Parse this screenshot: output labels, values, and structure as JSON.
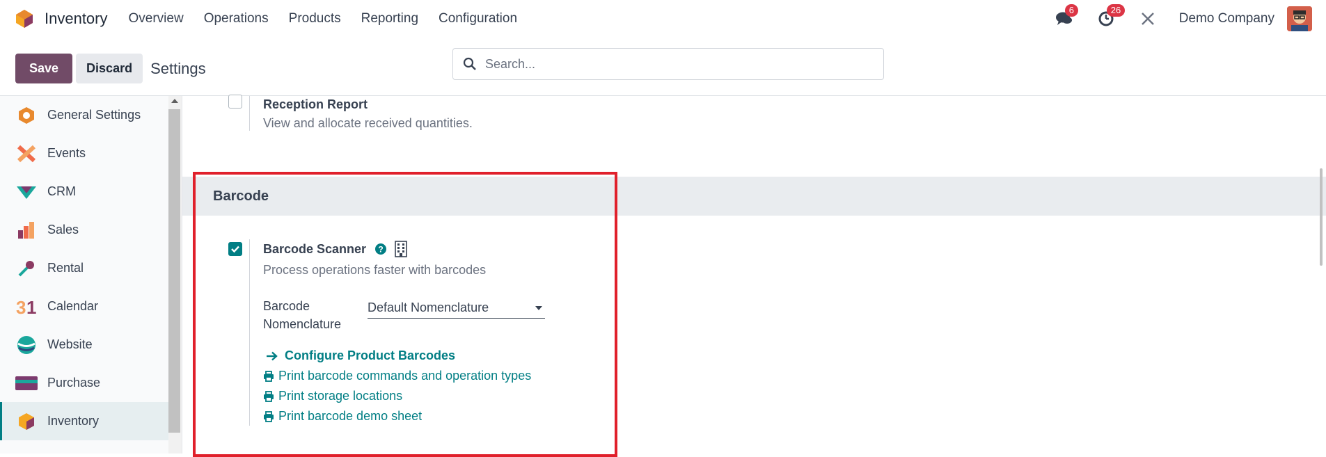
{
  "topnav": {
    "app_name": "Inventory",
    "menu": [
      "Overview",
      "Operations",
      "Products",
      "Reporting",
      "Configuration"
    ],
    "messages_count": "6",
    "activities_count": "26",
    "company": "Demo Company"
  },
  "control": {
    "save_label": "Save",
    "discard_label": "Discard",
    "title": "Settings",
    "search_placeholder": "Search..."
  },
  "sidebar": {
    "items": [
      {
        "label": "General Settings",
        "icon": "general-settings-icon"
      },
      {
        "label": "Events",
        "icon": "events-icon"
      },
      {
        "label": "CRM",
        "icon": "crm-icon"
      },
      {
        "label": "Sales",
        "icon": "sales-icon"
      },
      {
        "label": "Rental",
        "icon": "rental-icon"
      },
      {
        "label": "Calendar",
        "icon": "calendar-icon"
      },
      {
        "label": "Website",
        "icon": "website-icon"
      },
      {
        "label": "Purchase",
        "icon": "purchase-icon"
      },
      {
        "label": "Inventory",
        "icon": "inventory-icon"
      }
    ],
    "active": "Inventory"
  },
  "reception": {
    "title": "Reception Report",
    "desc": "View and allocate received quantities."
  },
  "barcode": {
    "section_title": "Barcode",
    "scanner_title": "Barcode Scanner",
    "scanner_desc": "Process operations faster with barcodes",
    "nomenclature_label_1": "Barcode",
    "nomenclature_label_2": "Nomenclature",
    "nomenclature_value": "Default Nomenclature",
    "configure_link": "Configure Product Barcodes",
    "print_commands": "Print barcode commands and operation types",
    "print_locations": "Print storage locations",
    "print_demo": "Print barcode demo sheet"
  },
  "colors": {
    "brand": "#714b67",
    "teal": "#017e84",
    "highlight": "#e0202b"
  }
}
